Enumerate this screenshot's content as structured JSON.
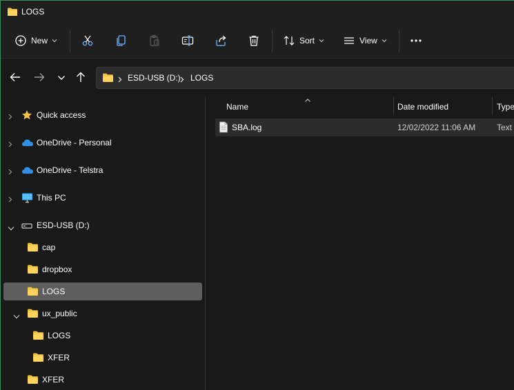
{
  "window": {
    "title": "LOGS"
  },
  "toolbar": {
    "new_label": "New",
    "sort_label": "Sort",
    "view_label": "View"
  },
  "address": {
    "crumbs": [
      "ESD-USB (D:)",
      "LOGS"
    ]
  },
  "sidebar": {
    "items": [
      {
        "label": "Quick access",
        "icon": "star-icon",
        "expanded": false
      },
      {
        "label": "OneDrive - Personal",
        "icon": "cloud-icon",
        "expanded": false
      },
      {
        "label": "OneDrive - Telstra",
        "icon": "cloud-icon",
        "expanded": false
      },
      {
        "label": "This PC",
        "icon": "monitor-icon",
        "expanded": false
      },
      {
        "label": "ESD-USB (D:)",
        "icon": "drive-icon",
        "expanded": true
      },
      {
        "label": "cap",
        "icon": "folder-icon"
      },
      {
        "label": "dropbox",
        "icon": "folder-icon"
      },
      {
        "label": "LOGS",
        "icon": "folder-icon",
        "selected": true
      },
      {
        "label": "ux_public",
        "icon": "folder-icon",
        "expanded": true
      },
      {
        "label": "LOGS",
        "icon": "folder-icon"
      },
      {
        "label": "XFER",
        "icon": "folder-icon"
      },
      {
        "label": "XFER",
        "icon": "folder-icon"
      }
    ]
  },
  "filelist": {
    "columns": [
      "Name",
      "Date modified",
      "Type"
    ],
    "rows": [
      {
        "name": "SBA.log",
        "date": "12/02/2022 11:06 AM",
        "type": "Text"
      }
    ]
  },
  "colors": {
    "background": "#191919",
    "toolbar": "#1f1f1f",
    "selected": "#5e5e5e",
    "folder": "#f5c342",
    "accent_cloud": "#2f8ee6"
  }
}
